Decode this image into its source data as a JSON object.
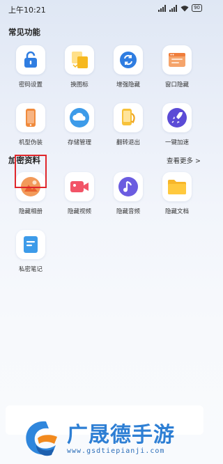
{
  "status_bar": {
    "time": "上午10:21",
    "battery": "90"
  },
  "common_functions": {
    "title": "常见功能",
    "items": [
      {
        "label": "密码设置",
        "icon": "lock-icon"
      },
      {
        "label": "换图标",
        "icon": "swap-icon"
      },
      {
        "label": "增强隐藏",
        "icon": "refresh-icon"
      },
      {
        "label": "窗口隐藏",
        "icon": "window-icon"
      },
      {
        "label": "机型伪装",
        "icon": "phone-icon"
      },
      {
        "label": "存储管理",
        "icon": "cloud-icon"
      },
      {
        "label": "翻转退出",
        "icon": "flip-phone-icon"
      },
      {
        "label": "一键加速",
        "icon": "rocket-icon"
      }
    ]
  },
  "encrypted_data": {
    "title": "加密资料",
    "view_more": "查看更多 >",
    "items": [
      {
        "label": "隐藏相册",
        "icon": "photo-icon",
        "highlighted": true
      },
      {
        "label": "隐藏视频",
        "icon": "video-icon"
      },
      {
        "label": "隐藏音频",
        "icon": "music-icon"
      },
      {
        "label": "隐藏文档",
        "icon": "folder-icon"
      },
      {
        "label": "私密笔记",
        "icon": "note-icon"
      }
    ]
  },
  "watermark": {
    "text": "广晟德手游",
    "url": "www.gsdtiepianji.com"
  },
  "colors": {
    "accent_blue": "#2f7de1",
    "highlight_red": "#e0262b",
    "orange": "#f5a623",
    "purple": "#5b4bd6"
  }
}
